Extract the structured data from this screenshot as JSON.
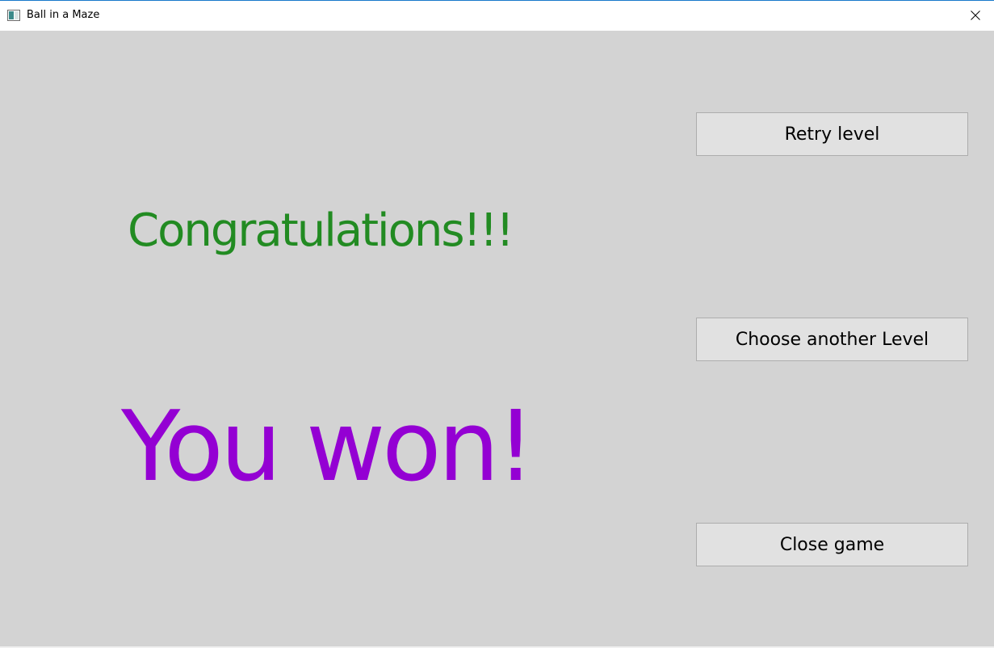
{
  "window": {
    "title": "Ball in a Maze",
    "icon": "app-window-icon",
    "close_icon": "close-icon"
  },
  "main": {
    "congrats_text": "Congratulations!!!",
    "won_text": "You won!"
  },
  "buttons": {
    "retry_label": "Retry level",
    "choose_label": "Choose another Level",
    "close_label": "Close game"
  },
  "colors": {
    "congrats": "#228b22",
    "won": "#9400d3",
    "background": "#d3d3d3",
    "button": "#e1e1e1"
  }
}
